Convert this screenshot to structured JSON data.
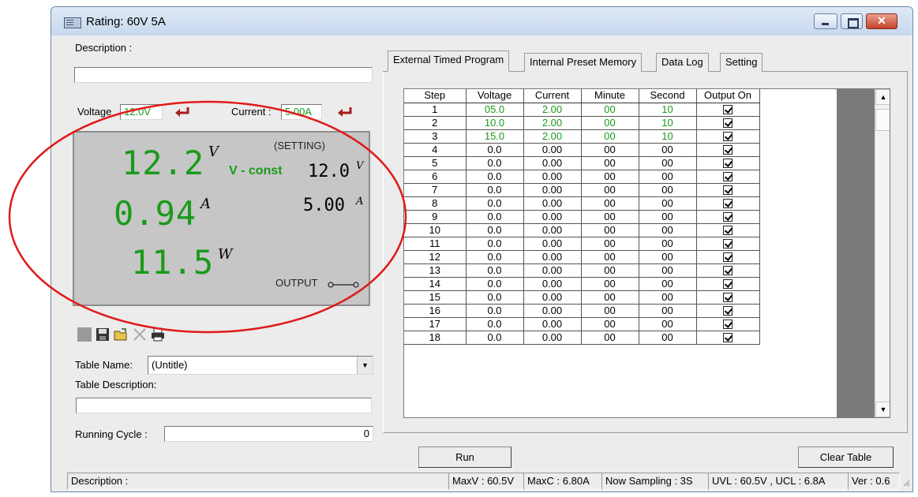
{
  "window": {
    "title": "Rating: 60V 5A",
    "close_glyph": "✕"
  },
  "left": {
    "description_label": "Description :",
    "description_value": "",
    "voltage_label": "Voltage",
    "voltage_value": "12.0V",
    "current_label": "Current :",
    "current_value": "5.00A",
    "enter_icon_color": "#a81d1d"
  },
  "display": {
    "voltage": "12.2",
    "voltage_unit": "V",
    "current": "0.94",
    "current_unit": "A",
    "power": "11.5",
    "power_unit": "W",
    "setting_label": "(SETTING)",
    "mode": "V - const",
    "set_voltage": "12.0",
    "set_voltage_unit": "V",
    "set_current": "5.00",
    "set_current_unit": "A",
    "output_label": "OUTPUT",
    "digit_color": "#1a9a1a"
  },
  "toolbar": [
    "new-icon",
    "save-icon",
    "open-icon",
    "delete-icon",
    "print-icon"
  ],
  "table_form": {
    "name_label": "Table Name:",
    "name_value": "(Untitle)",
    "desc_label": "Table Description:",
    "desc_value": "",
    "cycle_label": "Running Cycle :",
    "cycle_value": "0"
  },
  "tabs": [
    "External Timed Program",
    "Internal Preset Memory",
    "Data Log",
    "Setting"
  ],
  "grid": {
    "headers": [
      "Step",
      "Voltage",
      "Current",
      "Minute",
      "Second",
      "Output On"
    ],
    "rows": [
      [
        "1",
        "05.0",
        "2.00",
        "00",
        "10",
        true
      ],
      [
        "2",
        "10.0",
        "2.00",
        "00",
        "10",
        true
      ],
      [
        "3",
        "15.0",
        "2.00",
        "00",
        "10",
        true
      ],
      [
        "4",
        "0.0",
        "0.00",
        "00",
        "00",
        true
      ],
      [
        "5",
        "0.0",
        "0.00",
        "00",
        "00",
        true
      ],
      [
        "6",
        "0.0",
        "0.00",
        "00",
        "00",
        true
      ],
      [
        "7",
        "0.0",
        "0.00",
        "00",
        "00",
        true
      ],
      [
        "8",
        "0.0",
        "0.00",
        "00",
        "00",
        true
      ],
      [
        "9",
        "0.0",
        "0.00",
        "00",
        "00",
        true
      ],
      [
        "10",
        "0.0",
        "0.00",
        "00",
        "00",
        true
      ],
      [
        "11",
        "0.0",
        "0.00",
        "00",
        "00",
        true
      ],
      [
        "12",
        "0.0",
        "0.00",
        "00",
        "00",
        true
      ],
      [
        "13",
        "0.0",
        "0.00",
        "00",
        "00",
        true
      ],
      [
        "14",
        "0.0",
        "0.00",
        "00",
        "00",
        true
      ],
      [
        "15",
        "0.0",
        "0.00",
        "00",
        "00",
        true
      ],
      [
        "16",
        "0.0",
        "0.00",
        "00",
        "00",
        true
      ],
      [
        "17",
        "0.0",
        "0.00",
        "00",
        "00",
        true
      ],
      [
        "18",
        "0.0",
        "0.00",
        "00",
        "00",
        true
      ]
    ]
  },
  "buttons": {
    "run": "Run",
    "clear": "Clear Table"
  },
  "status": {
    "description": "Description :",
    "maxv": "MaxV : 60.5V",
    "maxc": "MaxC : 6.80A",
    "sampling": "Now Sampling : 3S",
    "uvl_ucl": "UVL : 60.5V , UCL : 6.8A",
    "ver": "Ver : 0.6"
  },
  "annotation_color": "#e01b1b"
}
